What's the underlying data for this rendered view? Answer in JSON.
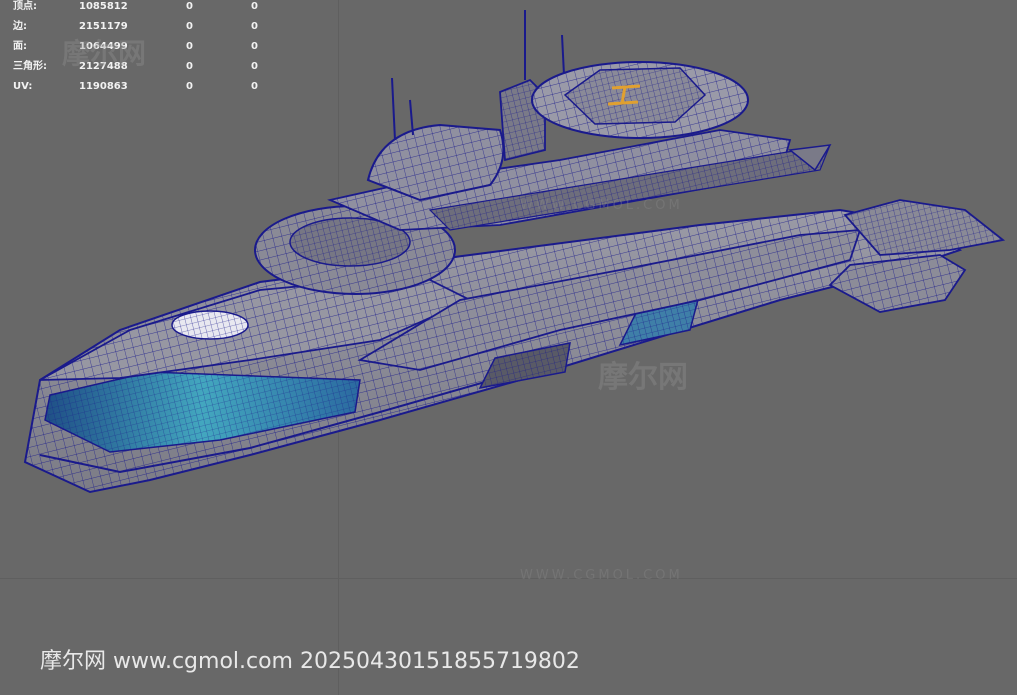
{
  "stats": {
    "rows": [
      {
        "label": "顶点:",
        "value": "1085812",
        "selected": "0",
        "selected2": "0"
      },
      {
        "label": "边:",
        "value": "2151179",
        "selected": "0",
        "selected2": "0"
      },
      {
        "label": "面:",
        "value": "1064499",
        "selected": "0",
        "selected2": "0"
      },
      {
        "label": "三角形:",
        "value": "2127488",
        "selected": "0",
        "selected2": "0"
      },
      {
        "label": "UV:",
        "value": "1190863",
        "selected": "0",
        "selected2": "0"
      }
    ]
  },
  "watermark": {
    "bottom_text": "摩尔网 www.cgmol.com 20250430151855719802",
    "logo_text": "摩尔网",
    "site_text": "WWW.CGMOL.COM"
  },
  "colors": {
    "background": "#686868",
    "wire": "#1a1a8c",
    "hull": "#8a8a92",
    "glass": "#3f9fb5",
    "helipad": "#e0a030"
  },
  "model": {
    "name": "yacht-wireframe"
  }
}
